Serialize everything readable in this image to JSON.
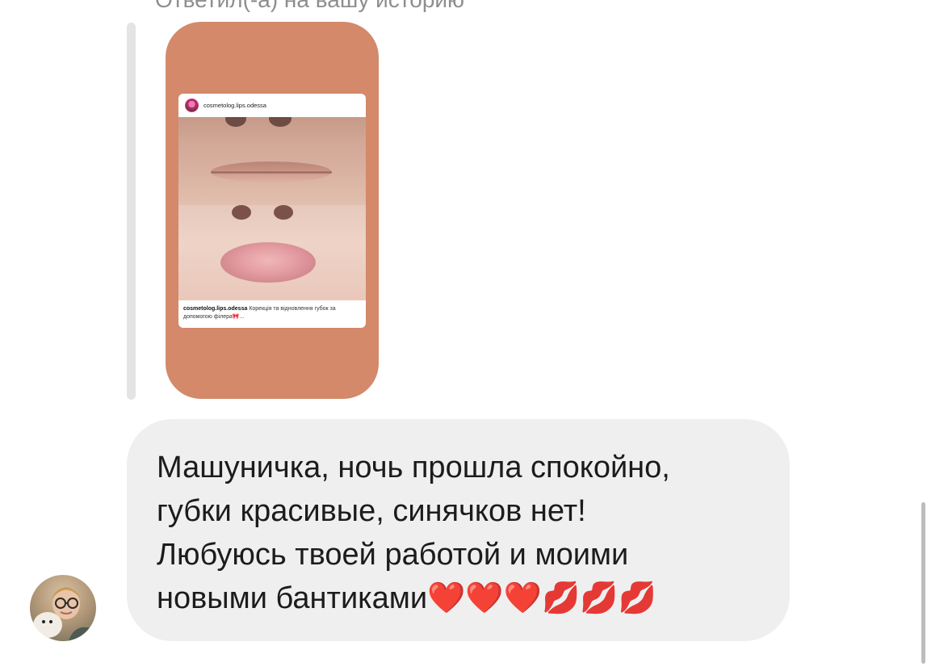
{
  "reply_header": "Ответил(-а) на вашу историю",
  "shared_post": {
    "username": "cosmetolog.lips.odessa",
    "caption_username": "cosmetolog.lips.odessa",
    "caption_text": "Корекція та відновлення губок за допомогою філера🎀..."
  },
  "message": {
    "text": "Машуничка, ночь прошла спокойно,\nгубки красивые, синячков нет!\nЛюбуюсь твоей работой и моими\nновыми бантиками❤️❤️❤️💋💋💋"
  },
  "colors": {
    "story_card_bg": "#d3896a",
    "bubble_bg": "#efefef",
    "reply_line": "#e4e4e4"
  }
}
